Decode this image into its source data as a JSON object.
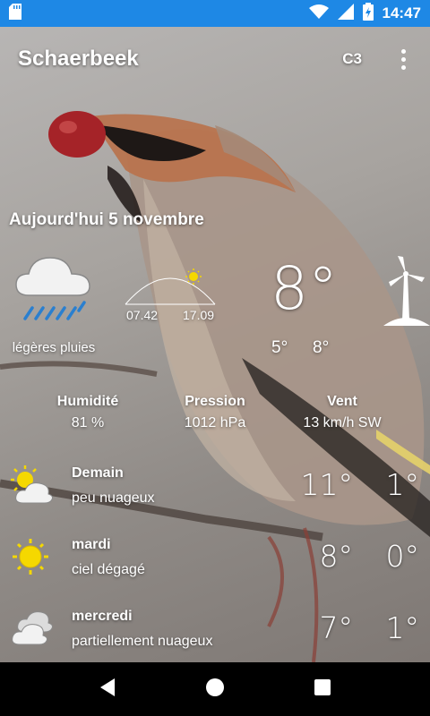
{
  "status_bar": {
    "time": "14:47",
    "icons": [
      "sd-card-icon",
      "wifi-icon",
      "signal-icon",
      "battery-charging-icon"
    ]
  },
  "app_bar": {
    "title": "Schaerbeek",
    "unit_label": "C3",
    "menu_icon": "more-vert-icon"
  },
  "today": {
    "heading": "Aujourd'hui 5 novembre",
    "icon": "cloud-rain-icon",
    "description": "légères pluies",
    "sunrise": "07.42",
    "sunset": "17.09",
    "current_temp": "8°",
    "min_temp": "5°",
    "max_temp": "8°",
    "wind_icon": "wind-turbine-icon"
  },
  "metrics": [
    {
      "label": "Humidité",
      "value": "81 %"
    },
    {
      "label": "Pression",
      "value": "1012 hPa"
    },
    {
      "label": "Vent",
      "value": "13 km/h SW"
    }
  ],
  "forecast": [
    {
      "day": "Demain",
      "condition": "peu nuageux",
      "high": "11°",
      "low": "1°",
      "icon": "sun-cloud-icon"
    },
    {
      "day": "mardi",
      "condition": "ciel dégagé",
      "high": "8°",
      "low": "0°",
      "icon": "sun-icon"
    },
    {
      "day": "mercredi",
      "condition": "partiellement nuageux",
      "high": "7°",
      "low": "1°",
      "icon": "cloud-icon"
    }
  ],
  "colors": {
    "status_bar": "#1e88e5",
    "sun": "#f5d800",
    "nav_bar": "#000000"
  }
}
